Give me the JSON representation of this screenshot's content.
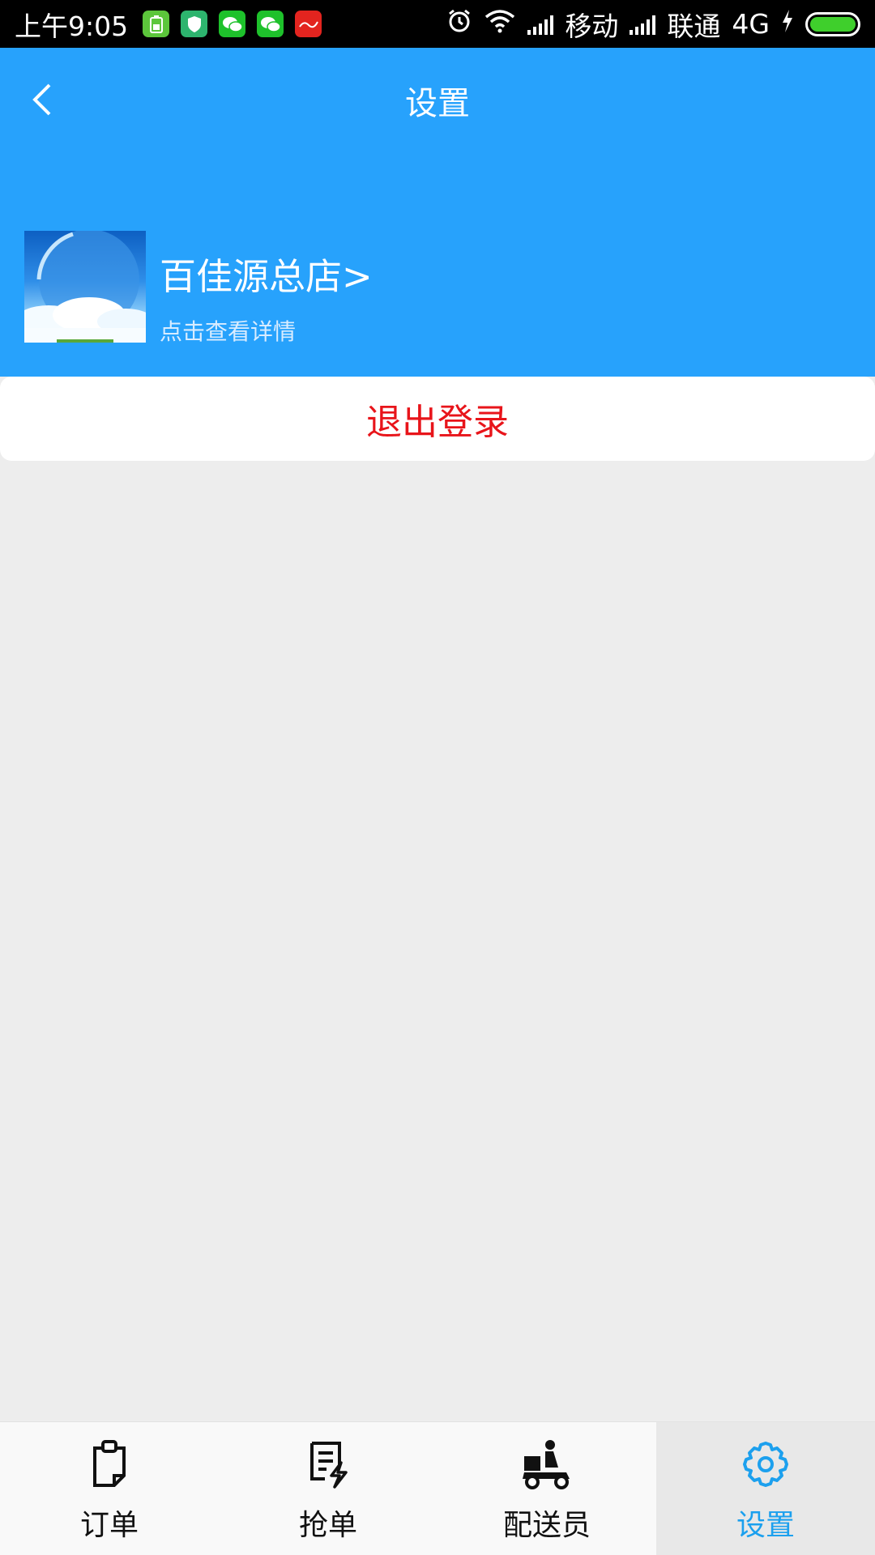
{
  "status_bar": {
    "time": "上午9:05",
    "carrier1": "移动",
    "carrier2": "联通",
    "network": "4G",
    "icons": [
      "battery-app-icon",
      "shield-app-icon",
      "wechat-icon",
      "wechat-icon",
      "red-app-icon",
      "alarm-icon",
      "wifi-icon",
      "signal-icon",
      "signal-icon",
      "charging-icon",
      "battery-icon"
    ]
  },
  "header": {
    "title": "设置",
    "back_icon": "chevron-left-icon",
    "background": "#27a2fc"
  },
  "profile": {
    "store_name": "百佳源总店>",
    "subtitle": "点击查看详情"
  },
  "logout": {
    "label": "退出登录",
    "color": "#e8141a"
  },
  "bottom_nav": {
    "items": [
      {
        "label": "订单",
        "icon": "clipboard-icon",
        "active": false
      },
      {
        "label": "抢单",
        "icon": "grab-order-icon",
        "active": false
      },
      {
        "label": "配送员",
        "icon": "courier-scooter-icon",
        "active": false
      },
      {
        "label": "设置",
        "icon": "gear-icon",
        "active": true
      }
    ],
    "active_color": "#1ca0ee"
  }
}
